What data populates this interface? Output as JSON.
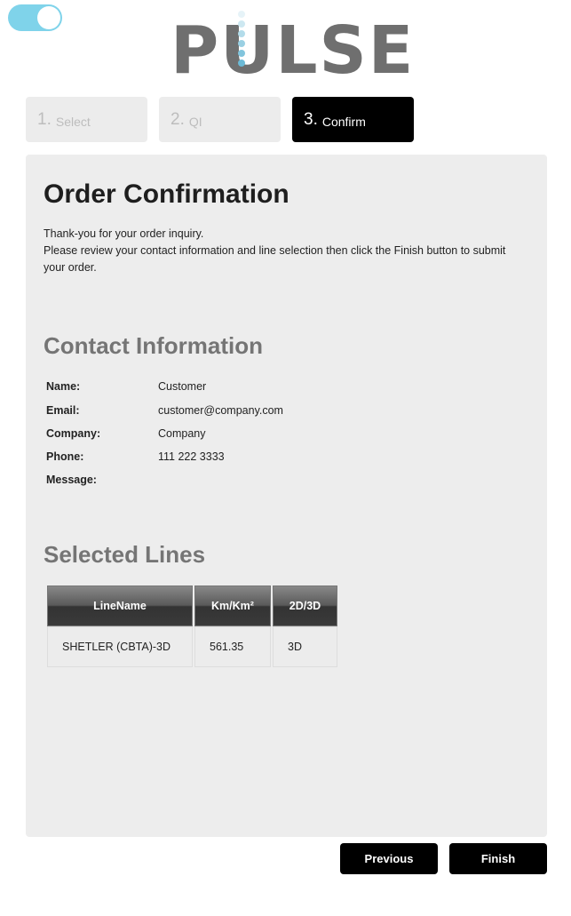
{
  "toggle": {
    "state": "on",
    "color": "#7fd3ea"
  },
  "logo": {
    "text": "PULSE",
    "dot_colors": [
      "#e6f3f8",
      "#cde8f1",
      "#b3dcea",
      "#9ad0e3",
      "#82c5dd",
      "#6cbad6"
    ]
  },
  "steps": [
    {
      "number": "1.",
      "label": "Select",
      "active": false
    },
    {
      "number": "2.",
      "label": "QI",
      "active": false
    },
    {
      "number": "3.",
      "label": "Confirm",
      "active": true
    }
  ],
  "main": {
    "title": "Order Confirmation",
    "intro_line1": "Thank-you for your order inquiry.",
    "intro_line2": "Please review your contact information and line selection then click the Finish button to submit your order."
  },
  "contact": {
    "heading": "Contact Information",
    "fields": [
      {
        "label": "Name:",
        "value": "Customer"
      },
      {
        "label": "Email:",
        "value": "customer@company.com"
      },
      {
        "label": "Company:",
        "value": "Company"
      },
      {
        "label": "Phone:",
        "value": "111 222 3333"
      },
      {
        "label": "Message:",
        "value": ""
      }
    ]
  },
  "selected_lines": {
    "heading": "Selected Lines",
    "columns": [
      "LineName",
      "Km/Km²",
      "2D/3D"
    ],
    "rows": [
      [
        "SHETLER (CBTA)-3D",
        "561.35",
        "3D"
      ]
    ]
  },
  "buttons": {
    "previous": "Previous",
    "finish": "Finish"
  }
}
